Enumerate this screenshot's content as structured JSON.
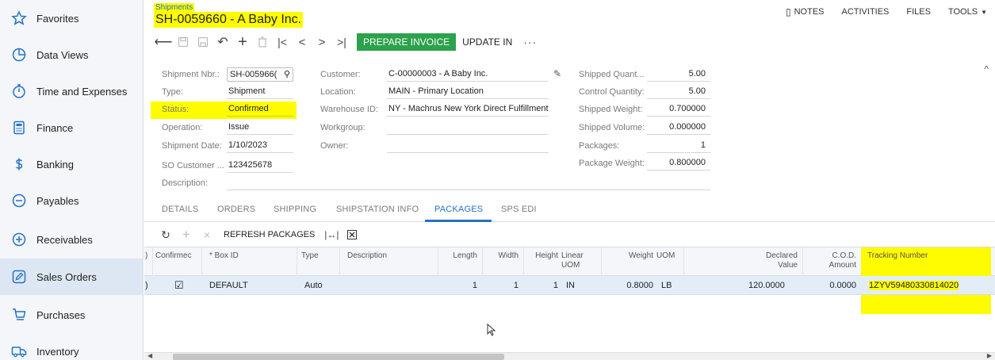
{
  "sidebar": {
    "items": [
      {
        "label": "Favorites",
        "icon": "star-icon"
      },
      {
        "label": "Data Views",
        "icon": "pie-chart-icon"
      },
      {
        "label": "Time and Expenses",
        "icon": "stopwatch-icon"
      },
      {
        "label": "Finance",
        "icon": "calculator-icon"
      },
      {
        "label": "Banking",
        "icon": "dollar-icon"
      },
      {
        "label": "Payables",
        "icon": "minus-circle-icon"
      },
      {
        "label": "Receivables",
        "icon": "plus-circle-icon"
      },
      {
        "label": "Sales Orders",
        "icon": "pencil-square-icon"
      },
      {
        "label": "Purchases",
        "icon": "cart-icon"
      },
      {
        "label": "Inventory",
        "icon": "truck-icon"
      }
    ]
  },
  "header": {
    "breadcrumb": "Shipments",
    "title": "SH-0059660 - A Baby Inc.",
    "links": {
      "notes": "NOTES",
      "activities": "ACTIVITIES",
      "files": "FILES",
      "tools": "TOOLS"
    }
  },
  "toolbar": {
    "prepare_invoice": "PREPARE INVOICE",
    "update_in": "UPDATE IN",
    "more": "···"
  },
  "form": {
    "shipment_nbr_label": "Shipment Nbr.:",
    "shipment_nbr_value": "SH-005966(",
    "type_label": "Type:",
    "type_value": "Shipment",
    "status_label": "Status:",
    "status_value": "Confirmed",
    "operation_label": "Operation:",
    "operation_value": "Issue",
    "shipment_date_label": "Shipment Date:",
    "shipment_date_value": "1/10/2023",
    "so_customer_label": "SO Customer ...",
    "so_customer_value": "123425678",
    "description_label": "Description:",
    "customer_label": "Customer:",
    "customer_value": "C-00000003 - A Baby Inc.",
    "location_label": "Location:",
    "location_value": "MAIN - Primary Location",
    "warehouse_label": "Warehouse ID:",
    "warehouse_value": "NY - Machrus New York Direct Fulfillment",
    "workgroup_label": "Workgroup:",
    "owner_label": "Owner:",
    "shipped_qty_label": "Shipped Quant...",
    "shipped_qty_value": "5.00",
    "control_qty_label": "Control Quantity:",
    "control_qty_value": "5.00",
    "shipped_weight_label": "Shipped Weight:",
    "shipped_weight_value": "0.700000",
    "shipped_volume_label": "Shipped Volume:",
    "shipped_volume_value": "0.000000",
    "packages_label": "Packages:",
    "packages_value": "1",
    "package_weight_label": "Package Weight:",
    "package_weight_value": "0.800000"
  },
  "tabs": [
    "DETAILS",
    "ORDERS",
    "SHIPPING",
    "SHIPSTATION INFO",
    "PACKAGES",
    "SPS EDI"
  ],
  "active_tab": "PACKAGES",
  "grid_toolbar": {
    "refresh": "REFRESH PACKAGES"
  },
  "grid": {
    "columns": {
      "first": ")",
      "confirmed": "Confirmec",
      "box_id": "* Box ID",
      "type": "Type",
      "description": "Description",
      "length": "Length",
      "width": "Width",
      "height": "Height",
      "linear_uom_1": "Linear",
      "linear_uom_2": "UOM",
      "weight": "Weight",
      "uom": "UOM",
      "declared_1": "Declared",
      "declared_2": "Value",
      "cod_1": "C.O.D.",
      "cod_2": "Amount",
      "tracking": "Tracking Number"
    },
    "rows": [
      {
        "first": ")",
        "confirmed": "☑",
        "box_id": "DEFAULT",
        "type": "Auto",
        "description": "",
        "length": "1",
        "width": "1",
        "height": "1",
        "linear_uom": "IN",
        "weight": "0.8000",
        "uom": "LB",
        "declared": "120.0000",
        "cod": "0.0000",
        "tracking": "1ZYV59480330814020"
      }
    ]
  },
  "colors": {
    "accent": "#2472c8",
    "highlight": "#fffc00",
    "action_green": "#2ba24c"
  }
}
